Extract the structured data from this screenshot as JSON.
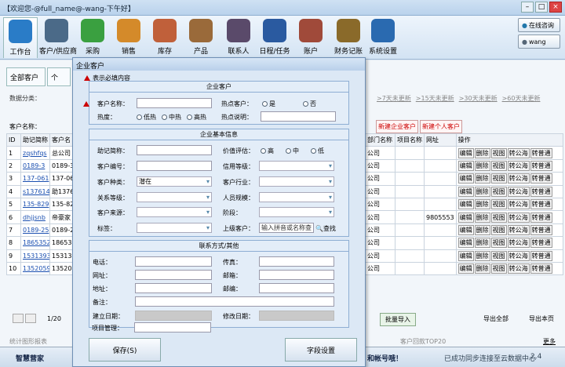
{
  "window": {
    "title": "【欢迎您-@full_name@-wang-下午好】"
  },
  "toolbar": {
    "items": [
      {
        "label": "工作台",
        "icon": "workbench-icon",
        "color": "#2a7cc7"
      },
      {
        "label": "客户/供应商",
        "icon": "customers-icon",
        "color": "#4b6a88"
      },
      {
        "label": "采购",
        "icon": "basket-icon",
        "color": "#3aa040"
      },
      {
        "label": "销售",
        "icon": "sales-icon",
        "color": "#d48a2a"
      },
      {
        "label": "库存",
        "icon": "warehouse-icon",
        "color": "#c0603a"
      },
      {
        "label": "产品",
        "icon": "box-icon",
        "color": "#9a6a3a"
      },
      {
        "label": "联系人",
        "icon": "contact-icon",
        "color": "#5a4a6a"
      },
      {
        "label": "日程/任务",
        "icon": "calendar-icon",
        "color": "#2a5aa0"
      },
      {
        "label": "账户",
        "icon": "tools-icon",
        "color": "#a04a3a"
      },
      {
        "label": "财务记账",
        "icon": "ledger-icon",
        "color": "#8a6a2a"
      },
      {
        "label": "系统设置",
        "icon": "settings-icon",
        "color": "#2a6ab0"
      }
    ],
    "online_label": "在线咨询",
    "user_label": "wang"
  },
  "tabs": [
    "全部客户",
    "个"
  ],
  "filter": {
    "label": "数据分类："
  },
  "blinks": [
    ">7天未更新",
    ">15天未更新",
    ">30天未更新",
    ">60天未更新"
  ],
  "search": {
    "label": "客户名称："
  },
  "new_buttons": [
    "新建企业客户",
    "新建个人客户"
  ],
  "grid": {
    "headers": [
      "ID",
      "助记简称",
      "客户名"
    ],
    "rows": [
      [
        "1",
        "zqshfqs",
        "总公司"
      ],
      [
        "2",
        "0189-3",
        "0189-3"
      ],
      [
        "3",
        "137-061",
        "137-06"
      ],
      [
        "4",
        "s137614",
        "助13761"
      ],
      [
        "5",
        "135-829",
        "135-82"
      ],
      [
        "6",
        "dhjjsnb",
        "帝豪家"
      ],
      [
        "7",
        "0189-25",
        "0189-2"
      ],
      [
        "8",
        "1865352",
        "18653"
      ],
      [
        "9",
        "1531393",
        "15313"
      ],
      [
        "10",
        "1352059",
        "13520"
      ]
    ]
  },
  "right": {
    "headers": [
      "部门名称",
      "项目名称",
      "网址",
      "操作"
    ],
    "rows": [
      [
        "公司",
        "",
        ""
      ],
      [
        "公司",
        "",
        ""
      ],
      [
        "公司",
        "",
        ""
      ],
      [
        "公司",
        "",
        ""
      ],
      [
        "公司",
        "",
        ""
      ],
      [
        "公司",
        "",
        "9805553"
      ],
      [
        "公司",
        "",
        ""
      ],
      [
        "公司",
        "",
        ""
      ],
      [
        "公司",
        "",
        ""
      ],
      [
        "公司",
        "",
        ""
      ]
    ],
    "actions": [
      "编辑",
      "删除",
      "视图",
      "转公海",
      "转普通"
    ]
  },
  "pager": {
    "page": "1/20",
    "import": "批量导入",
    "export_all": "导出全部",
    "export_page": "导出本页"
  },
  "bottom": {
    "left": "统计图形报表",
    "top20": "客户回款TOP20",
    "more": "更多"
  },
  "status": {
    "brand": "智慧营家",
    "msg": "和帐号哦！",
    "sync": "已成功同步连接至云数据中心",
    "ver": "2.4"
  },
  "dialog": {
    "title": "企业客户",
    "required_note": "表示必填内容",
    "g1": {
      "title": "企业客户",
      "name_label": "客户名称：",
      "hot_customer_label": "热点客户：",
      "yes": "是",
      "no": "否",
      "heat_label": "热度：",
      "low": "低热",
      "mid": "中热",
      "high": "高热",
      "hot_desc_label": "热点说明："
    },
    "g2": {
      "title": "企业基本信息",
      "abbr_label": "助记简称：",
      "value_label": "价值评估：",
      "v_high": "高",
      "v_mid": "中",
      "v_low": "低",
      "code_label": "客户编号：",
      "credit_label": "信用等级：",
      "type_label": "客户种类：",
      "type_value": "潜在",
      "industry_label": "客户行业：",
      "rel_label": "关系等级：",
      "staff_label": "人员规模：",
      "source_label": "客户来源：",
      "stage_label": "阶段：",
      "tag_label": "标签：",
      "parent_label": "上级客户：",
      "parent_placeholder": "输入拼音或名称查",
      "find": "查找"
    },
    "g3": {
      "title": "联系方式/其他",
      "phone": "电话：",
      "fax": "传真：",
      "url": "网址：",
      "email": "邮箱：",
      "addr": "地址：",
      "zip": "邮编：",
      "note": "备注：",
      "created": "建立日期：",
      "modified": "修改日期：",
      "pm": "项目管理："
    },
    "save": "保存(S)",
    "fields_setting": "字段设置"
  }
}
